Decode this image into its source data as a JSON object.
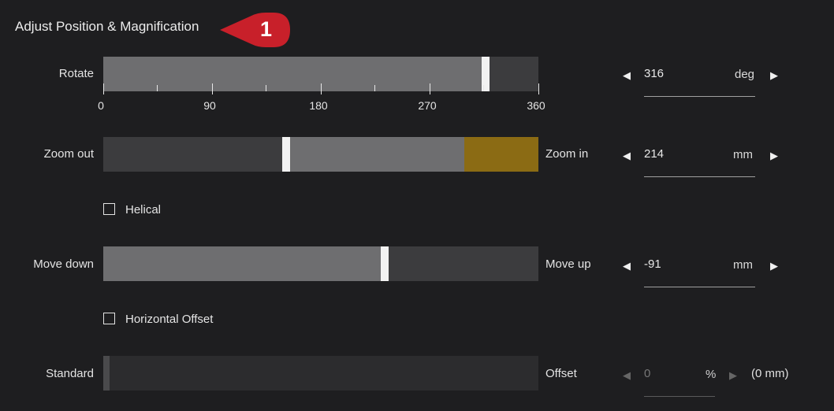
{
  "title": "Adjust Position & Magnification",
  "callout": {
    "number": "1",
    "color": "#c8202a"
  },
  "rotate": {
    "label": "Rotate",
    "value": "316",
    "unit": "deg",
    "fraction": 0.878,
    "ticks": [
      "0",
      "90",
      "180",
      "270",
      "360"
    ]
  },
  "zoom": {
    "label_left": "Zoom out",
    "label_right": "Zoom in",
    "value": "214",
    "unit": "mm",
    "fraction": 0.42,
    "warning_from": 0.83,
    "warning_color": "#8b6b14"
  },
  "helical": {
    "label": "Helical",
    "checked": false
  },
  "move": {
    "label_left": "Move down",
    "label_right": "Move up",
    "value": "-91",
    "unit": "mm",
    "fraction": 0.647
  },
  "horizontal_offset": {
    "label": "Horizontal Offset",
    "checked": false
  },
  "offset": {
    "label_left": "Standard",
    "label_right": "Offset",
    "value": "0",
    "unit": "%",
    "note": "(0 mm)",
    "fraction": 0.0,
    "enabled": false
  },
  "icons": {
    "decrement": "◀",
    "increment": "▶"
  }
}
